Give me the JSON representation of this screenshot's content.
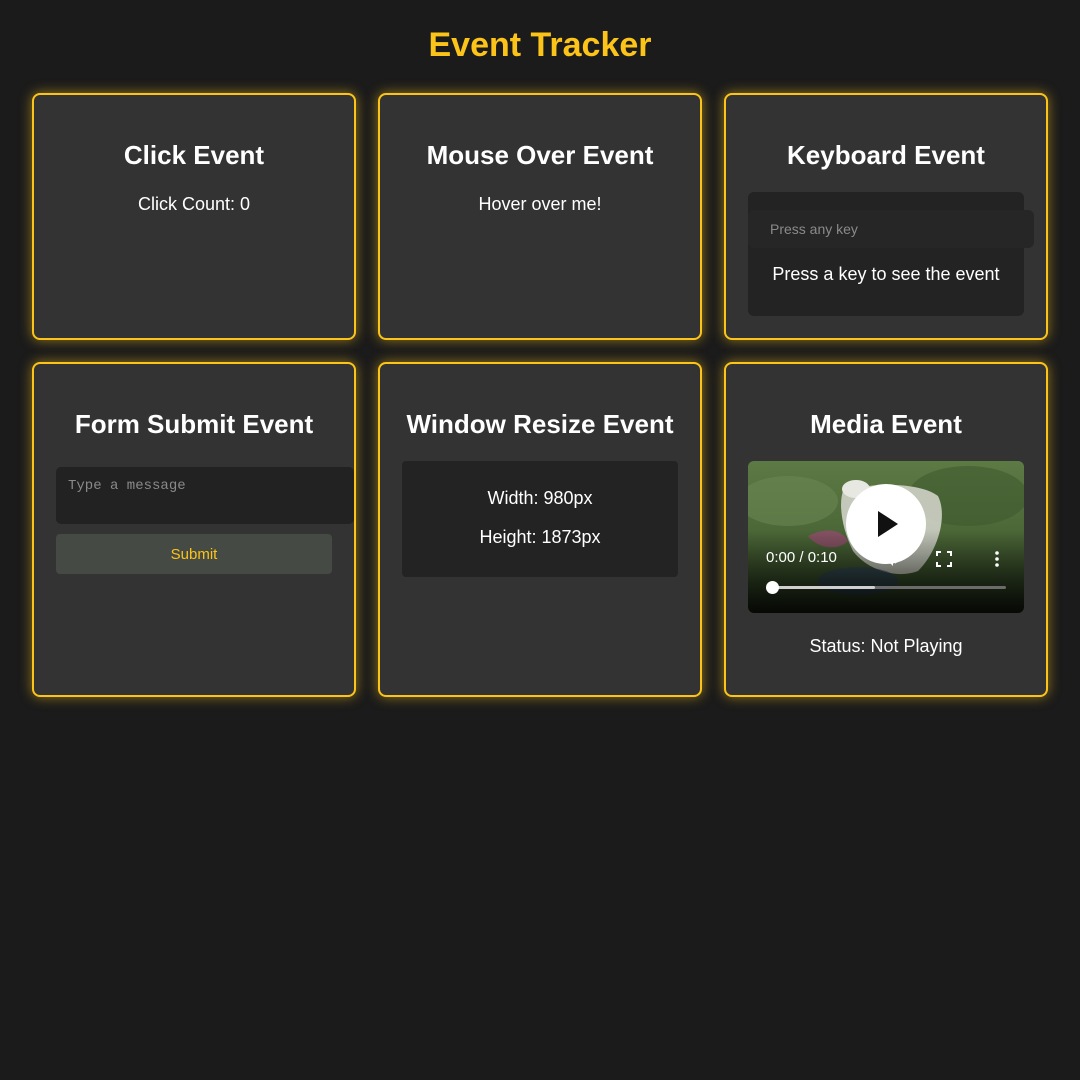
{
  "page": {
    "title": "Event Tracker",
    "accent_color": "#fcc419"
  },
  "click_card": {
    "title": "Click Event",
    "count_text": "Click Count: 0"
  },
  "hover_card": {
    "title": "Mouse Over Event",
    "text": "Hover over me!"
  },
  "keyboard_card": {
    "title": "Keyboard Event",
    "input_placeholder": "Press any key",
    "output_text": "Press a key to see the event"
  },
  "form_card": {
    "title": "Form Submit Event",
    "message_placeholder": "Type a message",
    "submit_label": "Submit"
  },
  "resize_card": {
    "title": "Window Resize Event",
    "width_text": "Width: 980px",
    "height_text": "Height: 1873px"
  },
  "media_card": {
    "title": "Media Event",
    "time_text": "0:00 / 0:10",
    "buffered_fraction": 0.44,
    "played_fraction": 0,
    "icons": [
      "play-icon",
      "volume-icon",
      "fullscreen-icon",
      "more-options-icon"
    ],
    "status_text": "Status: Not Playing"
  }
}
